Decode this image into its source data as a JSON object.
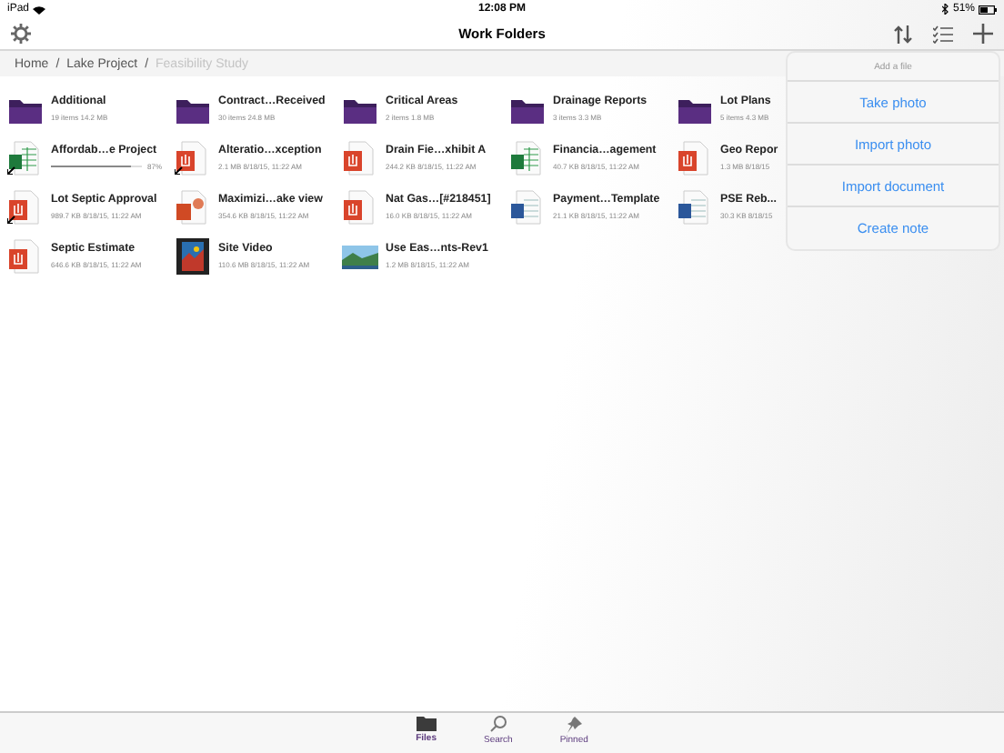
{
  "status_bar": {
    "device": "iPad",
    "time": "12:08 PM",
    "battery": "51%"
  },
  "nav": {
    "title": "Work Folders"
  },
  "breadcrumb": [
    {
      "label": "Home",
      "current": false
    },
    {
      "label": "Lake Project",
      "current": false
    },
    {
      "label": "Feasibility Study",
      "current": true
    }
  ],
  "separators": [
    "/",
    "/"
  ],
  "items": [
    {
      "kind": "folder",
      "name": "Additional",
      "meta": "19 items 14.2 MB",
      "syncing": false
    },
    {
      "kind": "folder",
      "name": "Contract…Received",
      "meta": "30 items 24.8 MB",
      "syncing": false
    },
    {
      "kind": "folder",
      "name": "Critical Areas",
      "meta": "2 items 1.8 MB",
      "syncing": false
    },
    {
      "kind": "folder",
      "name": "Drainage Reports",
      "meta": "3 items 3.3 MB",
      "syncing": false
    },
    {
      "kind": "folder",
      "name": "Lot Plans",
      "meta": "5 items 4.3 MB",
      "syncing": false
    },
    {
      "kind": "excel",
      "name": "Affordab…e Project",
      "syncing": true,
      "level": 0.87,
      "reading": "87%"
    },
    {
      "kind": "pdf",
      "name": "Alteratio…xception",
      "meta": "2.1 MB 8/18/15, 11:22 AM",
      "syncing": true
    },
    {
      "kind": "pdf",
      "name": "Drain Fie…xhibit A",
      "meta": "244.2 KB 8/18/15, 11:22 AM",
      "syncing": false
    },
    {
      "kind": "excel",
      "name": "Financia…agement",
      "meta": "40.7 KB 8/18/15, 11:22 AM",
      "syncing": false
    },
    {
      "kind": "pdf",
      "name": "Geo Repor",
      "meta": "1.3 MB 8/18/15",
      "syncing": false
    },
    {
      "kind": "pdf",
      "name": "Lot Septic Approval",
      "meta": "989.7 KB 8/18/15, 11:22 AM",
      "syncing": true
    },
    {
      "kind": "powerpoint",
      "name": "Maximizi…ake view",
      "meta": "354.6 KB 8/18/15, 11:22 AM",
      "syncing": false
    },
    {
      "kind": "pdf",
      "name": "Nat Gas…[#218451]",
      "meta": "16.0 KB 8/18/15, 11:22 AM",
      "syncing": false
    },
    {
      "kind": "word",
      "name": "Payment…Template",
      "meta": "21.1 KB 8/18/15, 11:22 AM",
      "syncing": false
    },
    {
      "kind": "word",
      "name": "PSE Reb...",
      "meta": "30.3 KB 8/18/15",
      "syncing": false
    },
    {
      "kind": "pdf",
      "name": "Septic Estimate",
      "meta": "646.6 KB 8/18/15, 11:22 AM",
      "syncing": false
    },
    {
      "kind": "video",
      "name": "Site Video",
      "meta": "110.6 MB 8/18/15, 11:22 AM",
      "syncing": false
    },
    {
      "name": "Use Eas…nts-Rev1",
      "meta": "1.2 MB 8/18/15, 11:22 AM",
      "syncing": false
    }
  ],
  "popover": {
    "title": "Add a file",
    "actions": [
      "Take photo",
      "Import photo",
      "Import document",
      "Create note"
    ]
  },
  "tabs": [
    {
      "label": "Files",
      "selected": true
    },
    {
      "label": "Search",
      "selected": false
    },
    {
      "label": "Pinned",
      "selected": false
    }
  ]
}
